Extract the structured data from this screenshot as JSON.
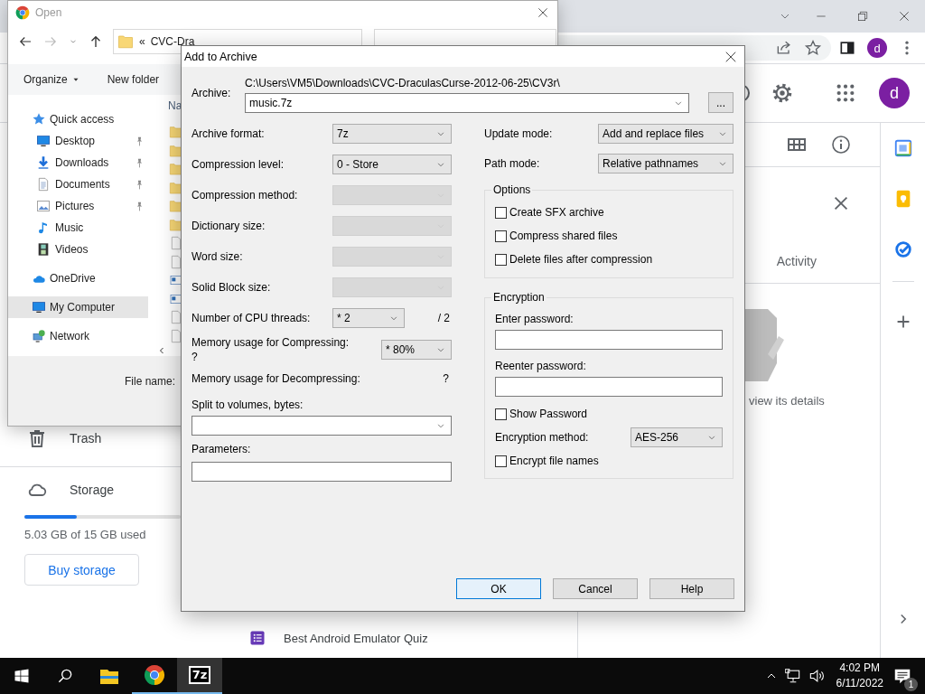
{
  "browser": {
    "avatar": "d"
  },
  "drive": {
    "avatar": "d",
    "details": {
      "tab": "Activity",
      "hint": "view its details"
    },
    "sidebar": [
      {
        "label": "Trash"
      },
      {
        "label": "Storage"
      }
    ],
    "storage": {
      "level": 0.335,
      "usage": "5.03 GB of 15 GB used",
      "button": "Buy storage"
    },
    "files": [
      {
        "name": "Best Android Emulator Quiz"
      }
    ]
  },
  "open_dialog": {
    "title": "Open",
    "address": {
      "prefix": "«",
      "folder": "CVC-Dra"
    },
    "toolbar": [
      {
        "label": "Organize",
        "menu": true
      },
      {
        "label": "New folder",
        "menu": false
      }
    ],
    "nav": [
      {
        "label": "Quick access",
        "selected": false,
        "children": [
          {
            "label": "Desktop",
            "pinned": true,
            "selected": false
          },
          {
            "label": "Downloads",
            "pinned": true,
            "selected": false
          },
          {
            "label": "Documents",
            "pinned": true,
            "selected": false
          },
          {
            "label": "Pictures",
            "pinned": true,
            "selected": false
          },
          {
            "label": "Music",
            "pinned": false,
            "selected": false
          },
          {
            "label": "Videos",
            "pinned": false,
            "selected": false
          }
        ]
      },
      {
        "label": "OneDrive",
        "selected": false
      },
      {
        "label": "My Computer",
        "selected": true
      },
      {
        "label": "Network",
        "selected": false
      }
    ],
    "column_header": "Na",
    "file_name_label": "File name:"
  },
  "archive_dialog": {
    "title": "Add to Archive",
    "archive": {
      "label": "Archive:",
      "path": "C:\\Users\\VM5\\Downloads\\CVC-DraculasCurse-2012-06-25\\CV3r\\",
      "value": "music.7z",
      "browse": "..."
    },
    "left_fields": [
      {
        "kind": "combo",
        "label": "Archive format:",
        "value": "7z",
        "disabled": false
      },
      {
        "kind": "combo",
        "label": "Compression level:",
        "value": "0 - Store",
        "disabled": false
      },
      {
        "kind": "combo",
        "label": "Compression method:",
        "disabled": true
      },
      {
        "kind": "combo",
        "label": "Dictionary size:",
        "disabled": true
      },
      {
        "kind": "combo",
        "label": "Word size:",
        "disabled": true
      },
      {
        "kind": "combo",
        "label": "Solid Block size:",
        "disabled": true
      },
      {
        "kind": "threads",
        "label": "Number of CPU threads:",
        "value": "* 2",
        "suffix": "/ 2",
        "disabled": false
      },
      {
        "kind": "memory",
        "label": "Memory usage for Compressing:",
        "note": "?",
        "value": "* 80%",
        "disabled": false
      },
      {
        "kind": "info",
        "label": "Memory usage for Decompressing:",
        "note": "?"
      },
      {
        "kind": "split",
        "label": "Split to volumes, bytes:"
      },
      {
        "kind": "params",
        "label": "Parameters:"
      }
    ],
    "right_fields": [
      {
        "label": "Update mode:",
        "value": "Add and replace files"
      },
      {
        "label": "Path mode:",
        "value": "Relative pathnames"
      }
    ],
    "options": {
      "title": "Options",
      "items": [
        {
          "label": "Create SFX archive",
          "checked": false
        },
        {
          "label": "Compress shared files",
          "checked": false
        },
        {
          "label": "Delete files after compression",
          "checked": false
        }
      ]
    },
    "encryption": {
      "title": "Encryption",
      "password_label": "Enter password:",
      "reenter_label": "Reenter password:",
      "show_password": {
        "label": "Show Password",
        "checked": false
      },
      "method": {
        "label": "Encryption method:",
        "value": "AES-256"
      },
      "encrypt_names": {
        "label": "Encrypt file names",
        "checked": false
      }
    },
    "buttons": [
      {
        "label": "OK",
        "default": true
      },
      {
        "label": "Cancel",
        "default": false
      },
      {
        "label": "Help",
        "default": false
      }
    ]
  },
  "taskbar": {
    "apps": [
      {
        "kind": "folder",
        "running": false,
        "selected": false
      },
      {
        "kind": "browser",
        "running": true,
        "selected": false
      },
      {
        "kind": "logo",
        "label": "7z",
        "running": true,
        "selected": true
      }
    ],
    "time": "4:02 PM",
    "date": "6/11/2022",
    "notifications": "1"
  }
}
